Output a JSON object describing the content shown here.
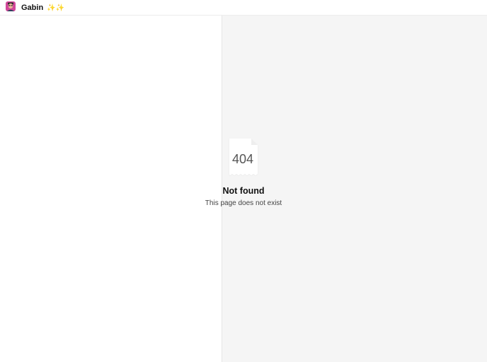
{
  "header": {
    "brand_name": "Gabin",
    "brand_emoji": "✨✨"
  },
  "error": {
    "code": "404",
    "title": "Not found",
    "message": "This page does not exist"
  },
  "icons": {
    "avatar": "user-avatar-icon",
    "document": "document-404-icon"
  },
  "colors": {
    "left_background": "#ffffff",
    "right_background": "#f5f5f5",
    "text_primary": "#111111",
    "text_secondary": "#444444"
  }
}
